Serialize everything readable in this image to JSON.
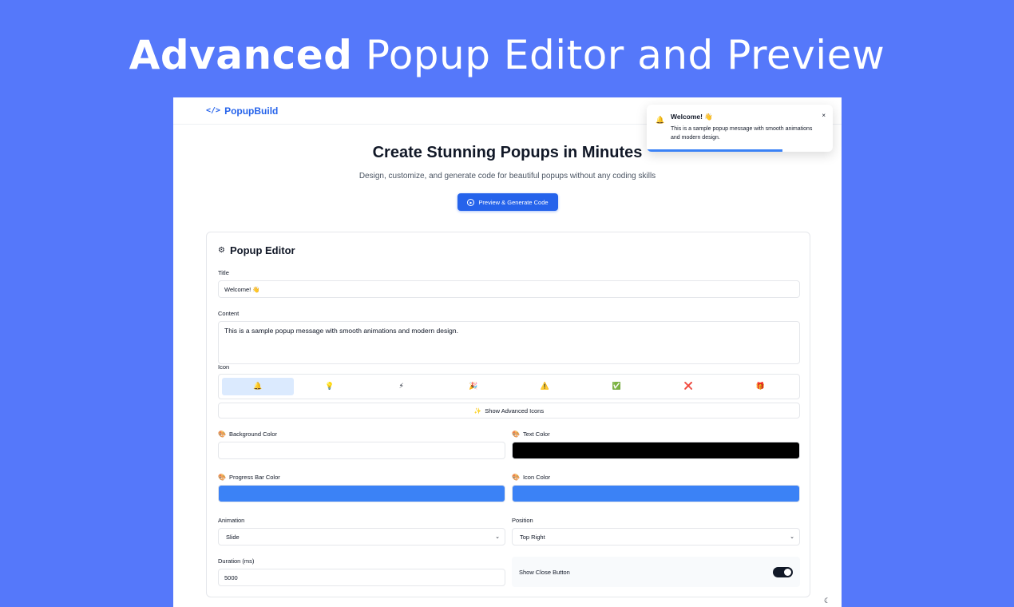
{
  "hero": {
    "title_bold": "Advanced",
    "title_rest": "Popup Editor and Preview"
  },
  "brand": {
    "icon": "code-icon",
    "name": "PopupBuild"
  },
  "header": {
    "headline": "Create Stunning Popups in Minutes",
    "subtitle": "Design, customize, and generate code for beautiful popups without any coding skills",
    "cta_label": "Preview & Generate Code"
  },
  "editor": {
    "title": "Popup Editor",
    "title_label": "Title",
    "title_value": "Welcome! 👋",
    "content_label": "Content",
    "content_value": "This is a sample popup message with smooth animations and modern design.",
    "icon_label": "Icon",
    "icons": [
      {
        "name": "bell-icon",
        "glyph": "🔔",
        "selected": true
      },
      {
        "name": "lightbulb-icon",
        "glyph": "💡",
        "selected": false
      },
      {
        "name": "lightning-icon",
        "glyph": "⚡",
        "selected": false
      },
      {
        "name": "party-icon",
        "glyph": "🎉",
        "selected": false
      },
      {
        "name": "warning-icon",
        "glyph": "⚠️",
        "selected": false
      },
      {
        "name": "check-icon",
        "glyph": "✅",
        "selected": false
      },
      {
        "name": "cross-icon",
        "glyph": "❌",
        "selected": false
      },
      {
        "name": "gift-icon",
        "glyph": "🎁",
        "selected": false
      }
    ],
    "advanced_icons_label": "Show Advanced Icons",
    "bg_color_label": "Background Color",
    "bg_color": "#ffffff",
    "text_color_label": "Text Color",
    "text_color": "#000000",
    "progress_color_label": "Progress Bar Color",
    "progress_color": "#3b82f6",
    "icon_color_label": "Icon Color",
    "icon_color": "#3b82f6",
    "animation_label": "Animation",
    "animation_value": "Slide",
    "position_label": "Position",
    "position_value": "Top Right",
    "duration_label": "Duration (ms)",
    "duration_value": "5000",
    "close_button_label": "Show Close Button",
    "close_button_on": true
  },
  "popup": {
    "title": "Welcome! 👋",
    "body": "This is a sample popup message with smooth animations and modern design.",
    "close_glyph": "×",
    "progress_fraction": 0.73
  },
  "colors": {
    "accent": "#2563eb",
    "background": "#5578fa"
  }
}
